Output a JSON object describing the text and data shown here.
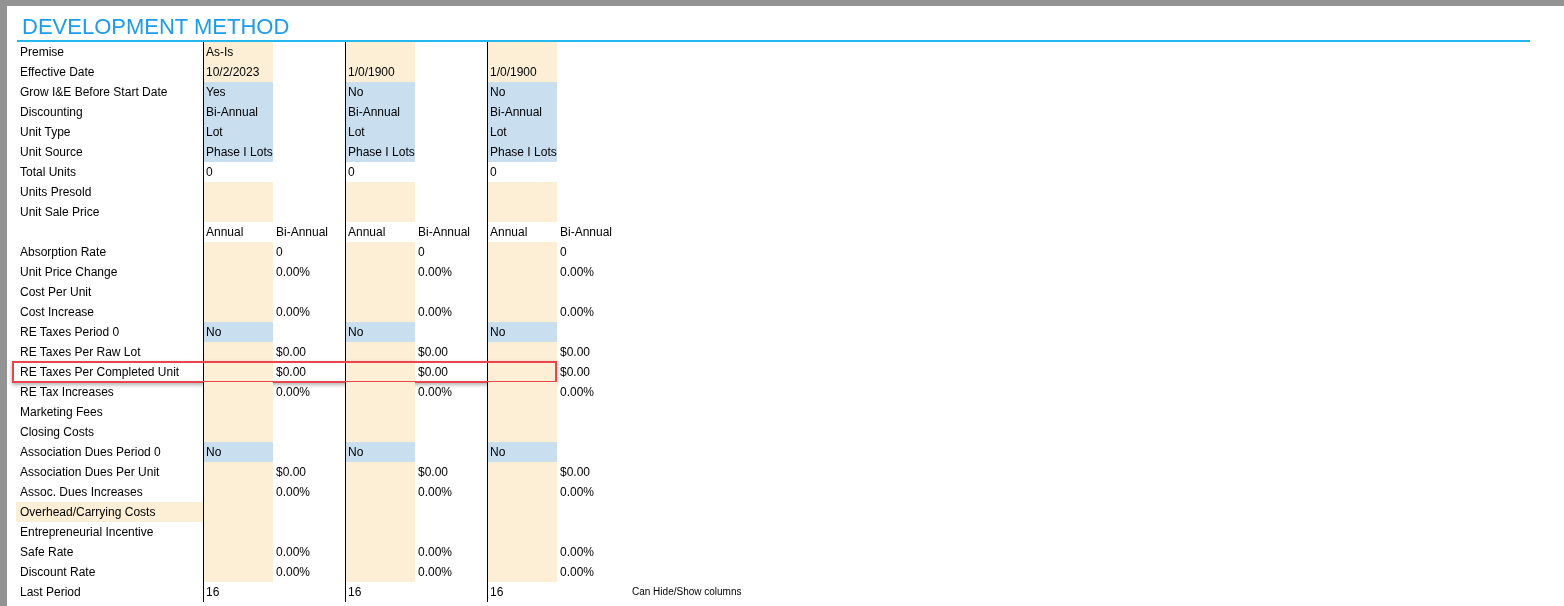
{
  "title": "DEVELOPMENT METHOD",
  "rows": [
    {
      "label": "Premise",
      "groups": [
        {
          "annual": {
            "text": "As-Is",
            "kind": "input"
          }
        },
        {
          "annual": {
            "kind": "input"
          }
        },
        {
          "annual": {
            "kind": "input"
          }
        }
      ]
    },
    {
      "label": "Effective Date",
      "groups": [
        {
          "annual": {
            "text": "10/2/2023",
            "kind": "input"
          }
        },
        {
          "annual": {
            "text": "1/0/1900",
            "kind": "input"
          }
        },
        {
          "annual": {
            "text": "1/0/1900",
            "kind": "input"
          }
        }
      ]
    },
    {
      "label": "Grow I&E Before Start Date",
      "groups": [
        {
          "annual": {
            "text": "Yes",
            "kind": "dropdown"
          }
        },
        {
          "annual": {
            "text": "No",
            "kind": "dropdown"
          }
        },
        {
          "annual": {
            "text": "No",
            "kind": "dropdown"
          }
        }
      ]
    },
    {
      "label": "Discounting",
      "groups": [
        {
          "annual": {
            "text": "Bi-Annual",
            "kind": "dropdown"
          }
        },
        {
          "annual": {
            "text": "Bi-Annual",
            "kind": "dropdown"
          }
        },
        {
          "annual": {
            "text": "Bi-Annual",
            "kind": "dropdown"
          }
        }
      ]
    },
    {
      "label": "Unit Type",
      "groups": [
        {
          "annual": {
            "text": "Lot",
            "kind": "dropdown"
          }
        },
        {
          "annual": {
            "text": "Lot",
            "kind": "dropdown"
          }
        },
        {
          "annual": {
            "text": "Lot",
            "kind": "dropdown"
          }
        }
      ]
    },
    {
      "label": "Unit Source",
      "groups": [
        {
          "annual": {
            "text": "Phase I Lots",
            "kind": "dropdown"
          }
        },
        {
          "annual": {
            "text": "Phase I Lots",
            "kind": "dropdown"
          }
        },
        {
          "annual": {
            "text": "Phase I Lots",
            "kind": "dropdown"
          }
        }
      ]
    },
    {
      "label": "Total Units",
      "groups": [
        {
          "annual": {
            "text": "0"
          }
        },
        {
          "annual": {
            "text": "0"
          }
        },
        {
          "annual": {
            "text": "0"
          }
        }
      ]
    },
    {
      "label": "Units Presold",
      "groups": [
        {
          "annual": {
            "kind": "input"
          }
        },
        {
          "annual": {
            "kind": "input"
          }
        },
        {
          "annual": {
            "kind": "input"
          }
        }
      ]
    },
    {
      "label": "Unit Sale Price",
      "groups": [
        {
          "annual": {
            "kind": "input"
          }
        },
        {
          "annual": {
            "kind": "input"
          }
        },
        {
          "annual": {
            "kind": "input"
          }
        }
      ]
    },
    {
      "groups": [
        {
          "annual": {
            "text": "Annual"
          },
          "bi_annual": {
            "text": "Bi-Annual"
          }
        },
        {
          "annual": {
            "text": "Annual"
          },
          "bi_annual": {
            "text": "Bi-Annual"
          }
        },
        {
          "annual": {
            "text": "Annual"
          },
          "bi_annual": {
            "text": "Bi-Annual"
          }
        }
      ]
    },
    {
      "label": "Absorption Rate",
      "groups": [
        {
          "annual": {
            "kind": "input"
          },
          "bi_annual": {
            "text": "0"
          }
        },
        {
          "annual": {
            "kind": "input"
          },
          "bi_annual": {
            "text": "0"
          }
        },
        {
          "annual": {
            "kind": "input"
          },
          "bi_annual": {
            "text": "0"
          }
        }
      ]
    },
    {
      "label": "Unit Price Change",
      "groups": [
        {
          "annual": {
            "kind": "input"
          },
          "bi_annual": {
            "text": "0.00%"
          }
        },
        {
          "annual": {
            "kind": "input"
          },
          "bi_annual": {
            "text": "0.00%"
          }
        },
        {
          "annual": {
            "kind": "input"
          },
          "bi_annual": {
            "text": "0.00%"
          }
        }
      ]
    },
    {
      "label": "Cost Per Unit",
      "groups": [
        {
          "annual": {
            "kind": "input"
          }
        },
        {
          "annual": {
            "kind": "input"
          }
        },
        {
          "annual": {
            "kind": "input"
          }
        }
      ]
    },
    {
      "label": "Cost Increase",
      "groups": [
        {
          "annual": {
            "kind": "input"
          },
          "bi_annual": {
            "text": "0.00%"
          }
        },
        {
          "annual": {
            "kind": "input"
          },
          "bi_annual": {
            "text": "0.00%"
          }
        },
        {
          "annual": {
            "kind": "input"
          },
          "bi_annual": {
            "text": "0.00%"
          }
        }
      ]
    },
    {
      "label": "RE Taxes Period 0",
      "groups": [
        {
          "annual": {
            "text": "No",
            "kind": "dropdown"
          }
        },
        {
          "annual": {
            "text": "No",
            "kind": "dropdown"
          }
        },
        {
          "annual": {
            "text": "No",
            "kind": "dropdown"
          }
        }
      ]
    },
    {
      "label": "RE Taxes Per Raw Lot",
      "groups": [
        {
          "annual": {
            "kind": "input"
          },
          "bi_annual": {
            "text": "$0.00"
          }
        },
        {
          "annual": {
            "kind": "input"
          },
          "bi_annual": {
            "text": "$0.00"
          }
        },
        {
          "annual": {
            "kind": "input"
          },
          "bi_annual": {
            "text": "$0.00"
          }
        }
      ]
    },
    {
      "label": "RE Taxes Per Completed Unit",
      "highlighted": true,
      "groups": [
        {
          "annual": {
            "kind": "input"
          },
          "bi_annual": {
            "text": "$0.00"
          }
        },
        {
          "annual": {
            "kind": "input"
          },
          "bi_annual": {
            "text": "$0.00"
          }
        },
        {
          "annual": {
            "kind": "input"
          },
          "bi_annual": {
            "text": "$0.00"
          }
        }
      ]
    },
    {
      "label": "RE Tax Increases",
      "groups": [
        {
          "annual": {
            "kind": "input"
          },
          "bi_annual": {
            "text": "0.00%"
          }
        },
        {
          "annual": {
            "kind": "input"
          },
          "bi_annual": {
            "text": "0.00%"
          }
        },
        {
          "annual": {
            "kind": "input"
          },
          "bi_annual": {
            "text": "0.00%"
          }
        }
      ]
    },
    {
      "label": "Marketing Fees",
      "groups": [
        {
          "annual": {
            "kind": "input"
          }
        },
        {
          "annual": {
            "kind": "input"
          }
        },
        {
          "annual": {
            "kind": "input"
          }
        }
      ]
    },
    {
      "label": "Closing Costs",
      "groups": [
        {
          "annual": {
            "kind": "input"
          }
        },
        {
          "annual": {
            "kind": "input"
          }
        },
        {
          "annual": {
            "kind": "input"
          }
        }
      ]
    },
    {
      "label": "Association Dues Period 0",
      "groups": [
        {
          "annual": {
            "text": "No",
            "kind": "dropdown"
          }
        },
        {
          "annual": {
            "text": "No",
            "kind": "dropdown"
          }
        },
        {
          "annual": {
            "text": "No",
            "kind": "dropdown"
          }
        }
      ]
    },
    {
      "label": "Association Dues Per Unit",
      "groups": [
        {
          "annual": {
            "kind": "input"
          },
          "bi_annual": {
            "text": "$0.00"
          }
        },
        {
          "annual": {
            "kind": "input"
          },
          "bi_annual": {
            "text": "$0.00"
          }
        },
        {
          "annual": {
            "kind": "input"
          },
          "bi_annual": {
            "text": "$0.00"
          }
        }
      ]
    },
    {
      "label": "Assoc. Dues Increases",
      "groups": [
        {
          "annual": {
            "kind": "input"
          },
          "bi_annual": {
            "text": "0.00%"
          }
        },
        {
          "annual": {
            "kind": "input"
          },
          "bi_annual": {
            "text": "0.00%"
          }
        },
        {
          "annual": {
            "kind": "input"
          },
          "bi_annual": {
            "text": "0.00%"
          }
        }
      ]
    },
    {
      "label": "Overhead/Carrying Costs",
      "label_shaded": true,
      "groups": [
        {
          "annual": {
            "kind": "input"
          }
        },
        {
          "annual": {
            "kind": "input"
          }
        },
        {
          "annual": {
            "kind": "input"
          }
        }
      ]
    },
    {
      "label": "Entrepreneurial Incentive",
      "groups": [
        {
          "annual": {
            "kind": "input"
          }
        },
        {
          "annual": {
            "kind": "input"
          }
        },
        {
          "annual": {
            "kind": "input"
          }
        }
      ]
    },
    {
      "label": "Safe Rate",
      "groups": [
        {
          "annual": {
            "kind": "input"
          },
          "bi_annual": {
            "text": "0.00%"
          }
        },
        {
          "annual": {
            "kind": "input"
          },
          "bi_annual": {
            "text": "0.00%"
          }
        },
        {
          "annual": {
            "kind": "input"
          },
          "bi_annual": {
            "text": "0.00%"
          }
        }
      ]
    },
    {
      "label": "Discount Rate",
      "groups": [
        {
          "annual": {
            "kind": "input"
          },
          "bi_annual": {
            "text": "0.00%"
          }
        },
        {
          "annual": {
            "kind": "input"
          },
          "bi_annual": {
            "text": "0.00%"
          }
        },
        {
          "annual": {
            "kind": "input"
          },
          "bi_annual": {
            "text": "0.00%"
          }
        }
      ]
    },
    {
      "label": "Last Period",
      "note": "Can Hide/Show columns",
      "groups": [
        {
          "annual": {
            "text": "16"
          }
        },
        {
          "annual": {
            "text": "16"
          }
        },
        {
          "annual": {
            "text": "16"
          }
        }
      ]
    }
  ]
}
